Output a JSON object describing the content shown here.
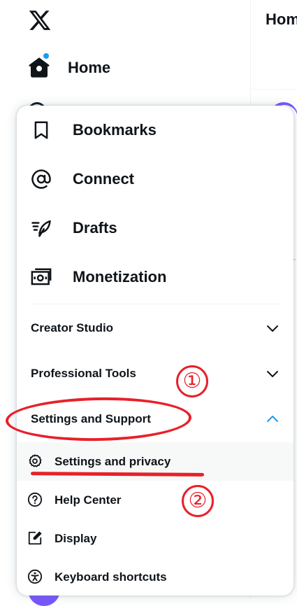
{
  "nav": {
    "home_label": "Home",
    "column_title": "Hom"
  },
  "menu": {
    "primary_items": [
      {
        "label": "Bookmarks",
        "icon": "bookmark-icon"
      },
      {
        "label": "Connect",
        "icon": "at-sign-icon"
      },
      {
        "label": "Drafts",
        "icon": "drafts-feather-icon"
      },
      {
        "label": "Monetization",
        "icon": "money-icon"
      }
    ],
    "sections": [
      {
        "label": "Creator Studio",
        "state": "collapsed"
      },
      {
        "label": "Professional Tools",
        "state": "collapsed"
      },
      {
        "label": "Settings and Support",
        "state": "expanded"
      }
    ],
    "settings_items": [
      {
        "label": "Settings and privacy",
        "icon": "gear-icon",
        "highlighted": true
      },
      {
        "label": "Help Center",
        "icon": "help-circle-icon"
      },
      {
        "label": "Display",
        "icon": "display-edit-icon"
      },
      {
        "label": "Keyboard shortcuts",
        "icon": "accessibility-icon"
      }
    ]
  },
  "annotations": {
    "step1": "①",
    "step2": "②",
    "color": "#e8202a"
  },
  "colors": {
    "accent": "#1d9bf0",
    "text": "#0f1419",
    "avatar": "#7856ff"
  }
}
